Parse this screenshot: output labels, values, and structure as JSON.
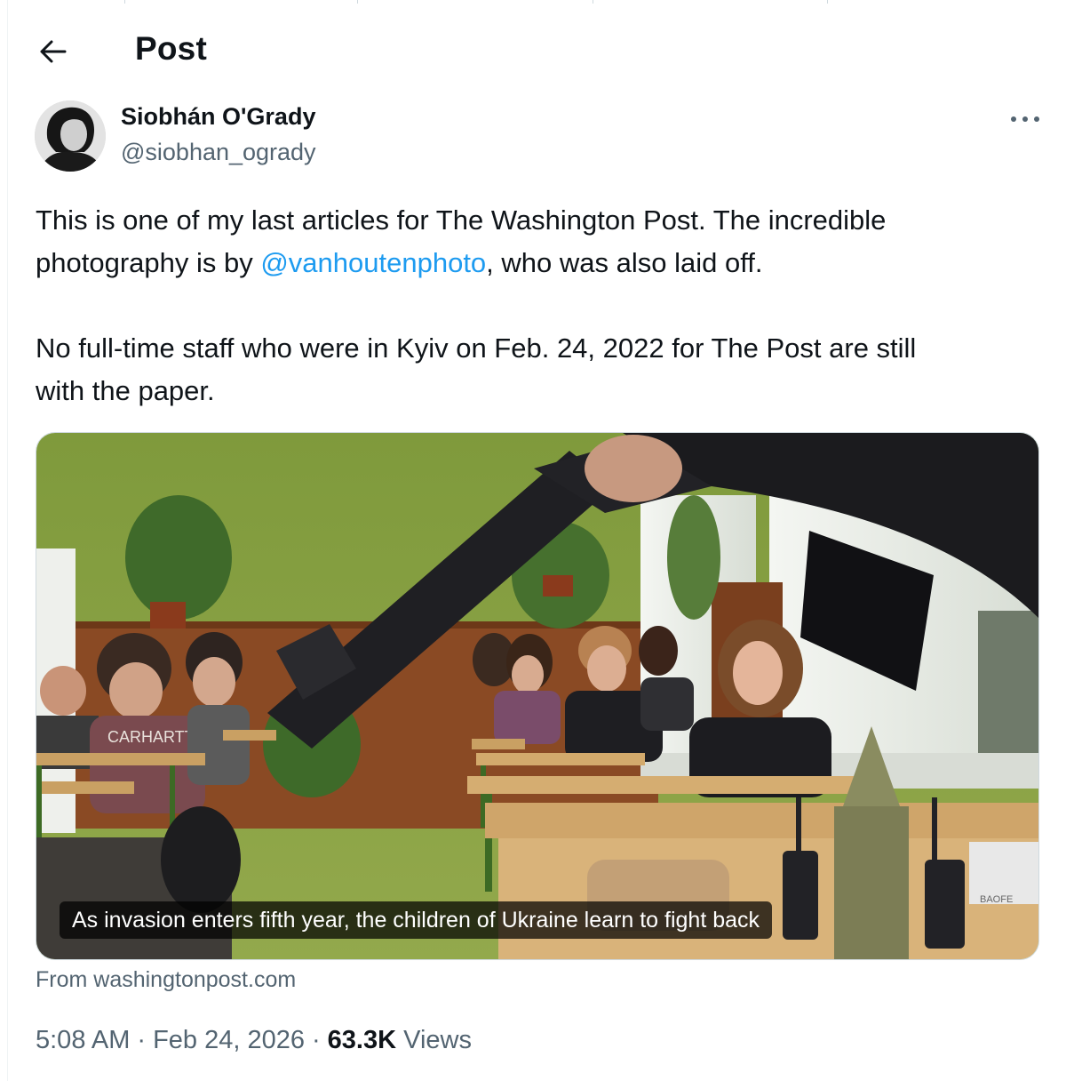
{
  "header": {
    "title": "Post",
    "back_icon": "arrow-left-icon"
  },
  "author": {
    "display_name": "Siobhán O'Grady",
    "handle": "@siobhan_ogrady",
    "avatar_alt": "avatar",
    "more_icon": "more-horizontal-icon"
  },
  "tweet": {
    "line1": "This is one of my last articles for The Washington Post. The incredible",
    "line2_prefix": "photography is by ",
    "mention": "@vanhoutenphoto",
    "line2_suffix": ", who was also laid off.",
    "line3": "No full-time staff who were in Kyiv on Feb. 24, 2022 for The Post are still",
    "line4": "with the paper."
  },
  "card": {
    "caption": "As invasion enters fifth year, the children of Ukraine learn to fight back",
    "source": "From washingtonpost.com",
    "photo_text_1": "CARHARTT",
    "photo_text_2": "BAOFE"
  },
  "meta": {
    "time": "5:08 AM",
    "separator": "·",
    "date": "Feb 24, 2026",
    "views_count": "63.3K",
    "views_label": "Views"
  },
  "colors": {
    "accent": "#1d9bf0",
    "text_primary": "#0f1419",
    "text_secondary": "#536471",
    "border": "#cfd9de"
  }
}
